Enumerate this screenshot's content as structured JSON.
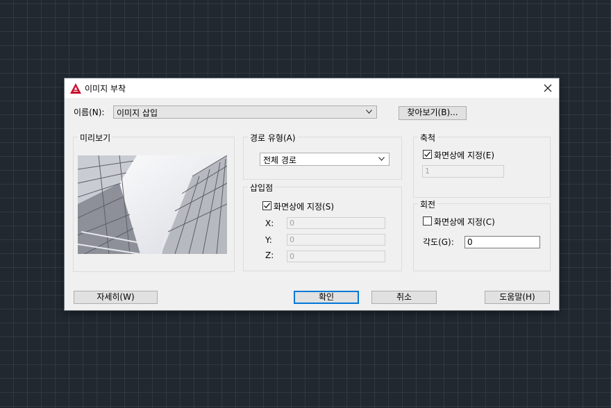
{
  "dialog": {
    "title": "이미지 부착",
    "close_glyph": "✕",
    "icon": "autocad-icon"
  },
  "name": {
    "label": "이름(N):",
    "value": "이미지 삽입",
    "browse_label": "찾아보기(B)..."
  },
  "preview": {
    "label": "미리보기"
  },
  "path_type": {
    "label": "경로 유형(A)",
    "value": "전체 경로"
  },
  "insertion": {
    "label": "삽입점",
    "specify_label": "화면상에 지정(S)",
    "specify_checked": true,
    "x_label": "X:",
    "x_value": "0",
    "y_label": "Y:",
    "y_value": "0",
    "z_label": "Z:",
    "z_value": "0"
  },
  "scale": {
    "label": "축척",
    "specify_label": "화면상에 지정(E)",
    "specify_checked": true,
    "value": "1"
  },
  "rotation": {
    "label": "회전",
    "specify_label": "화면상에 지정(C)",
    "specify_checked": false,
    "angle_label": "각도(G):",
    "angle_value": "0"
  },
  "buttons": {
    "details": "자세히(W)",
    "ok": "확인",
    "cancel": "취소",
    "help": "도움말(H)"
  }
}
